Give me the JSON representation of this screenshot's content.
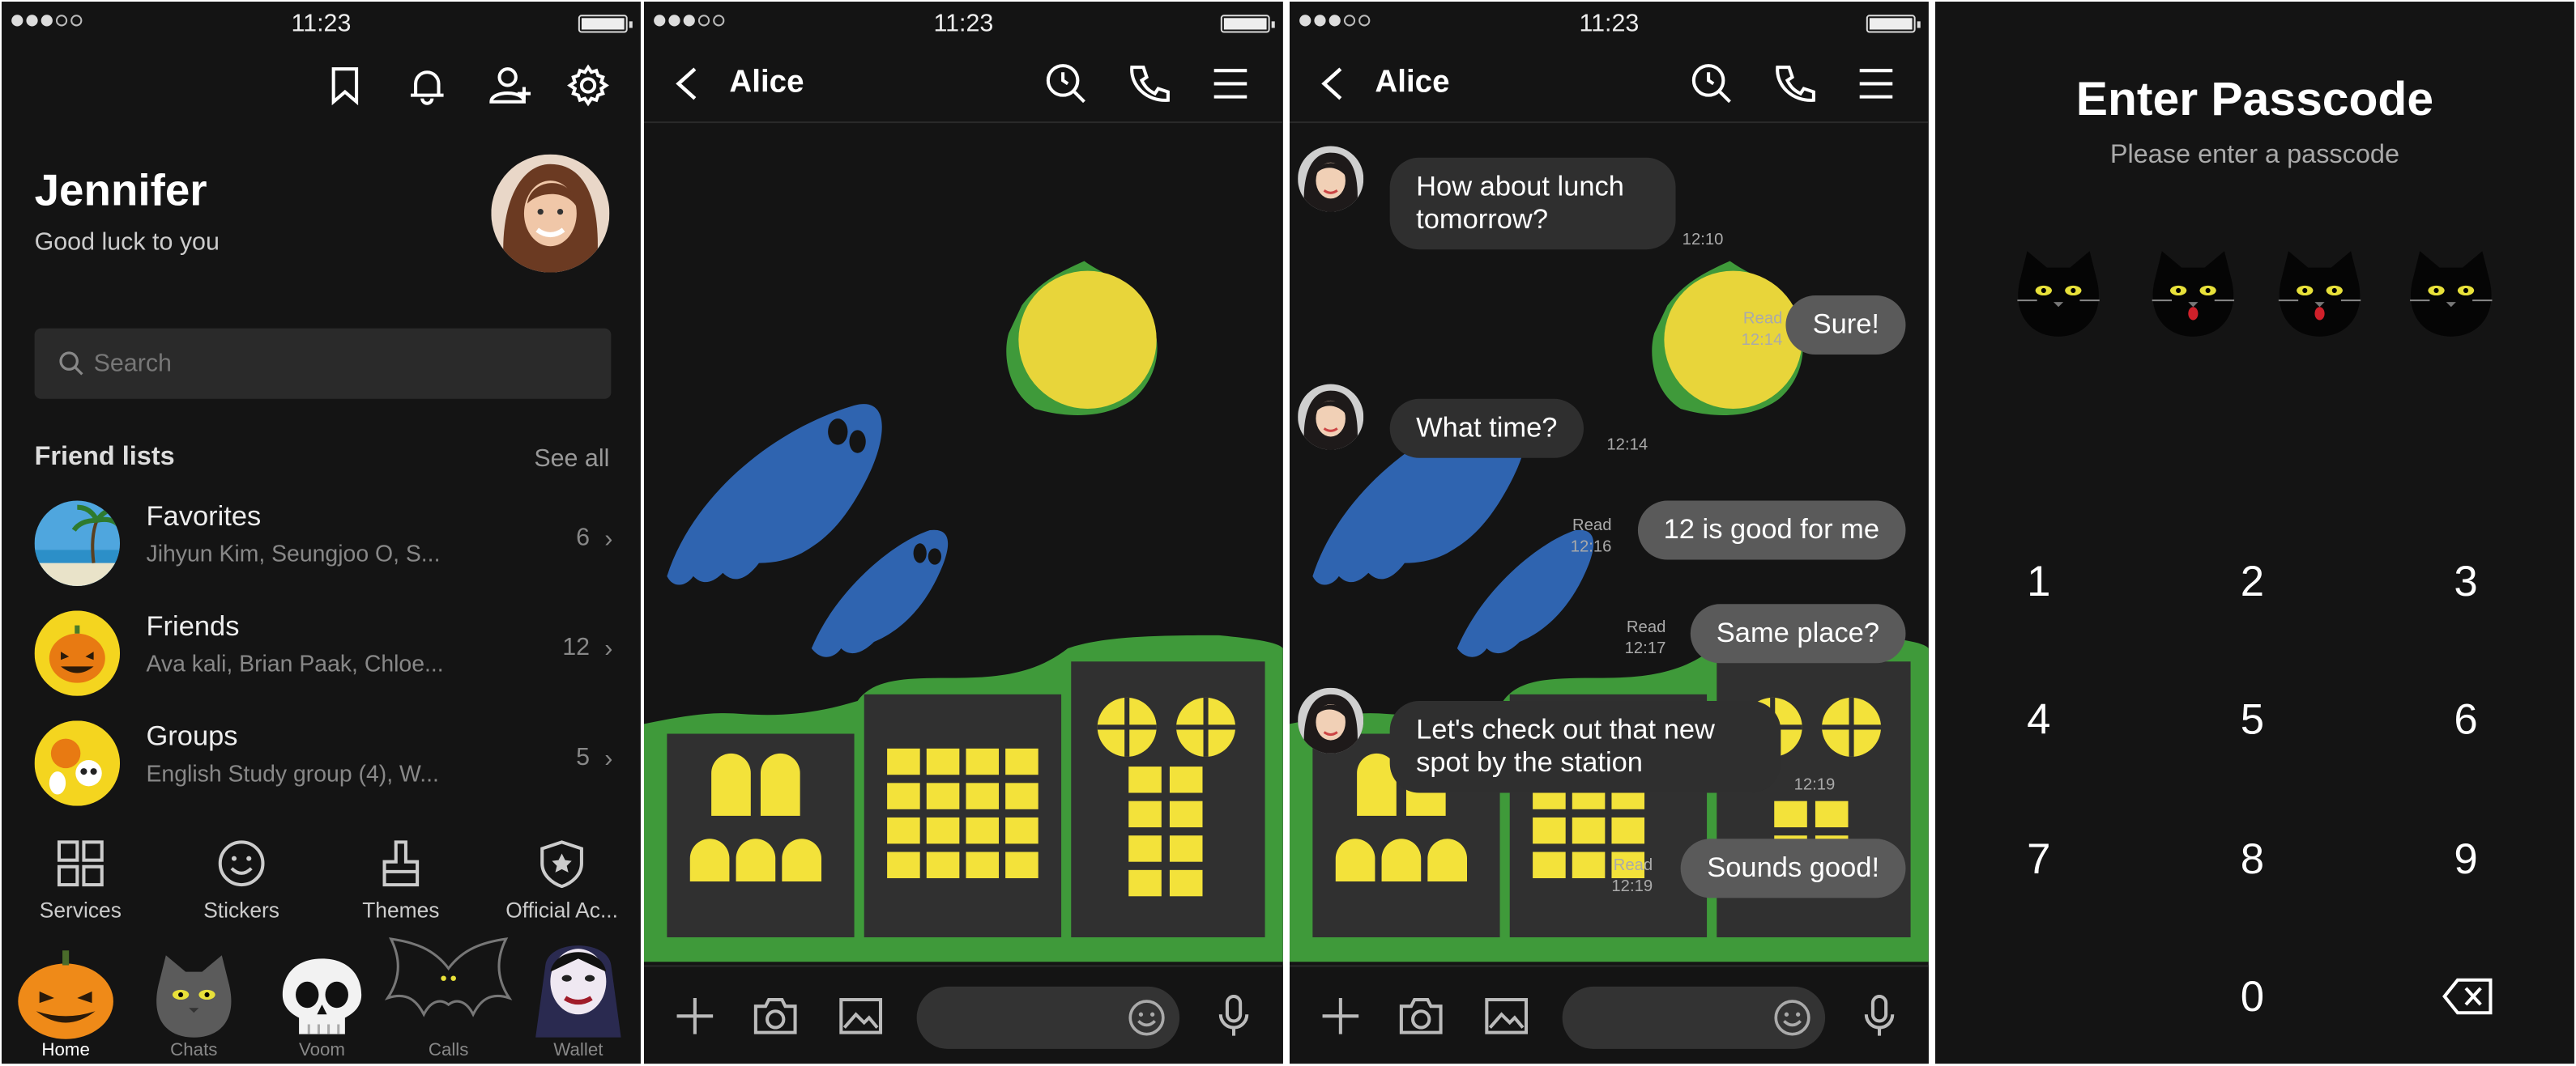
{
  "status": {
    "time": "11:23"
  },
  "home": {
    "profile_name": "Jennifer",
    "profile_status": "Good luck to you",
    "search_placeholder": "Search",
    "friend_lists_title": "Friend lists",
    "see_all": "See all",
    "lists": [
      {
        "title": "Favorites",
        "members": "Jihyun Kim, Seungjoo O, S...",
        "count": "6"
      },
      {
        "title": "Friends",
        "members": "Ava kali, Brian Paak, Chloe...",
        "count": "12"
      },
      {
        "title": "Groups",
        "members": "English Study group (4), W...",
        "count": "5"
      }
    ],
    "services": [
      {
        "label": "Services"
      },
      {
        "label": "Stickers"
      },
      {
        "label": "Themes"
      },
      {
        "label": "Official Ac..."
      }
    ],
    "tabs": [
      {
        "label": "Home",
        "active": true
      },
      {
        "label": "Chats"
      },
      {
        "label": "Voom"
      },
      {
        "label": "Calls"
      },
      {
        "label": "Wallet"
      }
    ]
  },
  "chat": {
    "contact_name": "Alice",
    "messages": [
      {
        "dir": "in",
        "text": "How about lunch tomorrow?",
        "time": "12:10"
      },
      {
        "dir": "out",
        "text": "Sure!",
        "read": "Read",
        "time": "12:14"
      },
      {
        "dir": "in",
        "text": "What time?",
        "time": "12:14"
      },
      {
        "dir": "out",
        "text": "12 is good for me",
        "read": "Read",
        "time": "12:16"
      },
      {
        "dir": "out",
        "text": "Same place?",
        "read": "Read",
        "time": "12:17"
      },
      {
        "dir": "in",
        "text": "Let's check out that new spot by the station",
        "time": "12:19"
      },
      {
        "dir": "out",
        "text": "Sounds good!",
        "read": "Read",
        "time": "12:19"
      }
    ]
  },
  "passcode": {
    "title": "Enter Passcode",
    "subtitle": "Please enter a passcode",
    "keys": [
      "1",
      "2",
      "3",
      "4",
      "5",
      "6",
      "7",
      "8",
      "9",
      "0"
    ]
  },
  "colors": {
    "background": "#141414",
    "moon": "#e8d53a",
    "moon_glow": "#3f9a3a",
    "ghost": "#2f64b0",
    "buildings": "#303030",
    "hills": "#3f9a3a",
    "windows": "#f3e23a"
  }
}
